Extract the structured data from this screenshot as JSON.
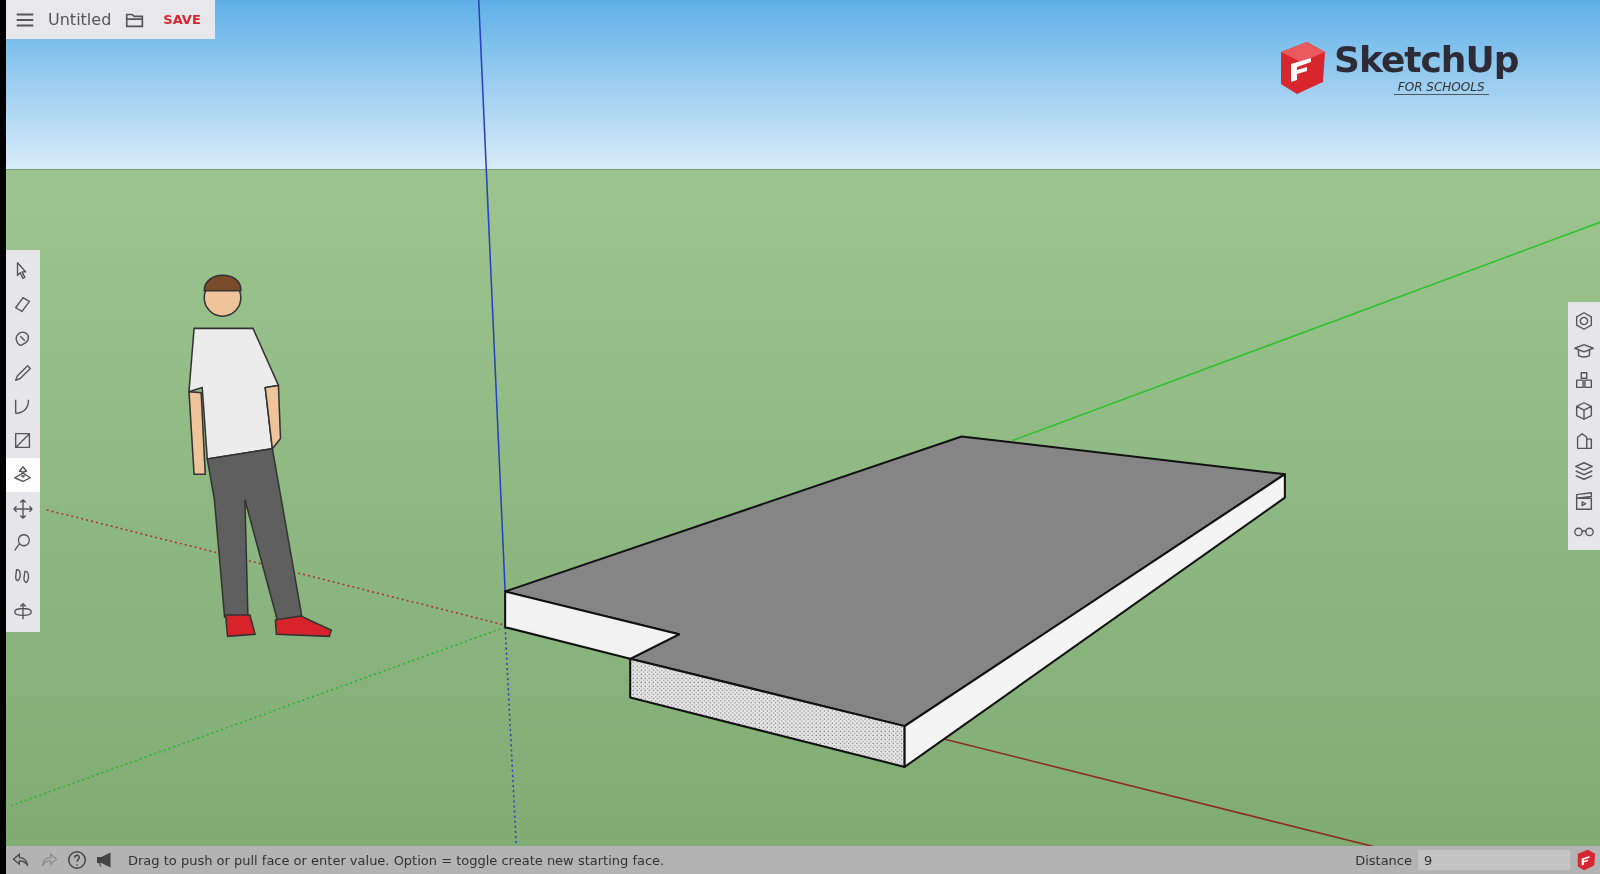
{
  "file_bar": {
    "title": "Untitled",
    "save": "SAVE"
  },
  "logo": {
    "name": "SketchUp",
    "tagline": "FOR SCHOOLS"
  },
  "tools": [
    {
      "selected": false
    },
    {
      "selected": false
    },
    {
      "selected": false
    },
    {
      "selected": false
    },
    {
      "selected": false
    },
    {
      "selected": false
    },
    {
      "selected": true
    },
    {
      "selected": false
    },
    {
      "selected": false
    },
    {
      "selected": false
    },
    {
      "selected": false
    }
  ],
  "panels": [
    {
      "selected": false
    },
    {
      "selected": false
    },
    {
      "selected": false
    },
    {
      "selected": false
    },
    {
      "selected": false
    },
    {
      "selected": false
    },
    {
      "selected": false
    },
    {
      "selected": false
    }
  ],
  "status_bar": {
    "undo": {
      "disabled": false
    },
    "redo": {
      "disabled": true
    },
    "message": "Drag to push or pull face or enter value. Option = toggle create new starting face.",
    "measure_label": "Distance",
    "measure_value": "9"
  }
}
